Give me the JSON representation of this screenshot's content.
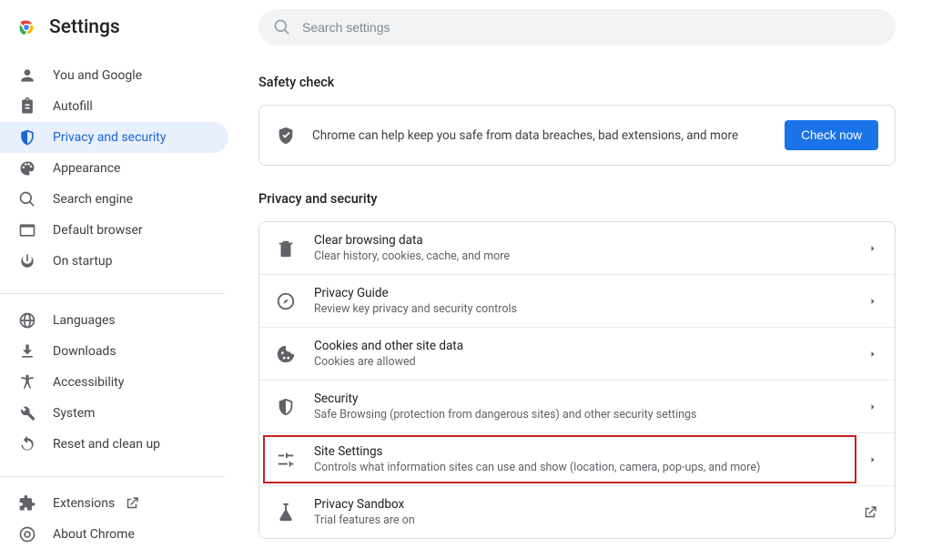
{
  "header": {
    "title": "Settings"
  },
  "search": {
    "placeholder": "Search settings"
  },
  "sidebar": {
    "group1": [
      {
        "label": "You and Google",
        "icon": "person-icon"
      },
      {
        "label": "Autofill",
        "icon": "clipboard-icon"
      },
      {
        "label": "Privacy and security",
        "icon": "shield-icon",
        "selected": true
      },
      {
        "label": "Appearance",
        "icon": "palette-icon"
      },
      {
        "label": "Search engine",
        "icon": "search-icon"
      },
      {
        "label": "Default browser",
        "icon": "browser-icon"
      },
      {
        "label": "On startup",
        "icon": "power-icon"
      }
    ],
    "group2": [
      {
        "label": "Languages",
        "icon": "globe-icon"
      },
      {
        "label": "Downloads",
        "icon": "download-icon"
      },
      {
        "label": "Accessibility",
        "icon": "accessibility-icon"
      },
      {
        "label": "System",
        "icon": "wrench-icon"
      },
      {
        "label": "Reset and clean up",
        "icon": "restore-icon"
      }
    ],
    "group3": [
      {
        "label": "Extensions",
        "icon": "extension-icon",
        "external": true
      },
      {
        "label": "About Chrome",
        "icon": "chrome-outline-icon"
      }
    ]
  },
  "sections": {
    "safety": {
      "title": "Safety check",
      "message": "Chrome can help keep you safe from data breaches, bad extensions, and more",
      "button": "Check now"
    },
    "privacy": {
      "title": "Privacy and security",
      "items": [
        {
          "title": "Clear browsing data",
          "sub": "Clear history, cookies, cache, and more",
          "icon": "trash-icon",
          "action": "chevron"
        },
        {
          "title": "Privacy Guide",
          "sub": "Review key privacy and security controls",
          "icon": "compass-icon",
          "action": "chevron"
        },
        {
          "title": "Cookies and other site data",
          "sub": "Cookies are allowed",
          "icon": "cookie-icon",
          "action": "chevron"
        },
        {
          "title": "Security",
          "sub": "Safe Browsing (protection from dangerous sites) and other security settings",
          "icon": "shield-icon",
          "action": "chevron"
        },
        {
          "title": "Site Settings",
          "sub": "Controls what information sites can use and show (location, camera, pop-ups, and more)",
          "icon": "sliders-icon",
          "action": "chevron",
          "highlighted": true
        },
        {
          "title": "Privacy Sandbox",
          "sub": "Trial features are on",
          "icon": "flask-icon",
          "action": "external"
        }
      ]
    }
  }
}
